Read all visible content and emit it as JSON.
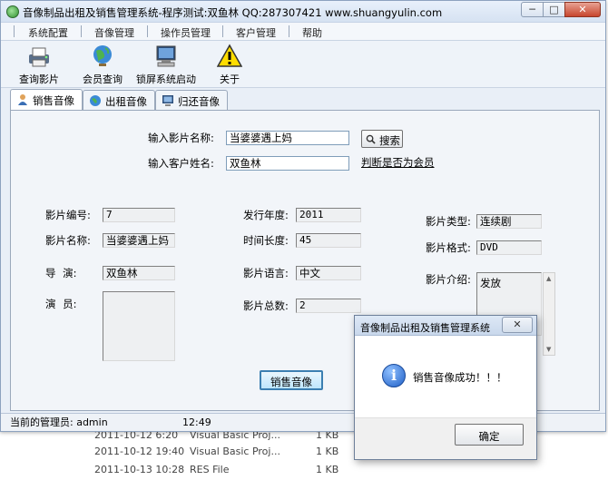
{
  "window": {
    "title": "音像制品出租及销售管理系统-程序测试:双鱼林 QQ:287307421 www.shuangyulin.com",
    "min_glyph": "─",
    "max_glyph": "□",
    "close_glyph": "✕"
  },
  "menu": {
    "items": [
      {
        "label": "系统配置"
      },
      {
        "label": "音像管理"
      },
      {
        "label": "操作员管理"
      },
      {
        "label": "客户管理"
      },
      {
        "label": "帮助"
      }
    ]
  },
  "toolbar": {
    "items": [
      {
        "label": "查询影片",
        "icon": "printer-icon"
      },
      {
        "label": "会员查询",
        "icon": "globe-icon"
      },
      {
        "label": "锁屏系统启动",
        "icon": "computer-icon"
      },
      {
        "label": "关于",
        "icon": "warning-icon"
      }
    ]
  },
  "tabs": [
    {
      "label": "销售音像",
      "icon": "person-icon"
    },
    {
      "label": "出租音像",
      "icon": "globe-icon"
    },
    {
      "label": "归还音像",
      "icon": "monitor-icon"
    }
  ],
  "search": {
    "title_label": "输入影片名称:",
    "title_value": "当婆婆遇上妈",
    "customer_label": "输入客户姓名:",
    "customer_value": "双鱼林",
    "search_button": "搜索",
    "member_link": "判断是否为会员"
  },
  "details": {
    "id_label": "影片编号:",
    "id_value": "7",
    "name_label": "影片名称:",
    "name_value": "当婆婆遇上妈",
    "director_label": "导    演:",
    "director_value": "双鱼林",
    "actors_label": "演    员:",
    "year_label": "发行年度:",
    "year_value": "2011",
    "length_label": "时间长度:",
    "length_value": "45",
    "language_label": "影片语言:",
    "language_value": "中文",
    "total_label": "影片总数:",
    "total_value": "2",
    "type_label": "影片类型:",
    "type_value": "连续剧",
    "format_label": "影片格式:",
    "format_value": "DVD",
    "intro_label": "影片介绍:",
    "intro_value": "发放"
  },
  "sell_button": "销售音像",
  "status": {
    "admin_label": "当前的管理员: admin",
    "time": "12:49"
  },
  "dialog": {
    "title": "音像制品出租及销售管理系统",
    "close_glyph": "✕",
    "message": "销售音像成功！！！",
    "ok_button": "确定",
    "icon": "info-icon"
  },
  "background_files": [
    {
      "date": "2011-10-12 6:20",
      "type": "Visual Basic Proj...",
      "size": "1 KB"
    },
    {
      "date": "2011-10-12 19:40",
      "type": "Visual Basic Proj...",
      "size": "1 KB"
    },
    {
      "date": "2011-10-13 10:28",
      "type": "RES File",
      "size": "1 KB"
    }
  ]
}
